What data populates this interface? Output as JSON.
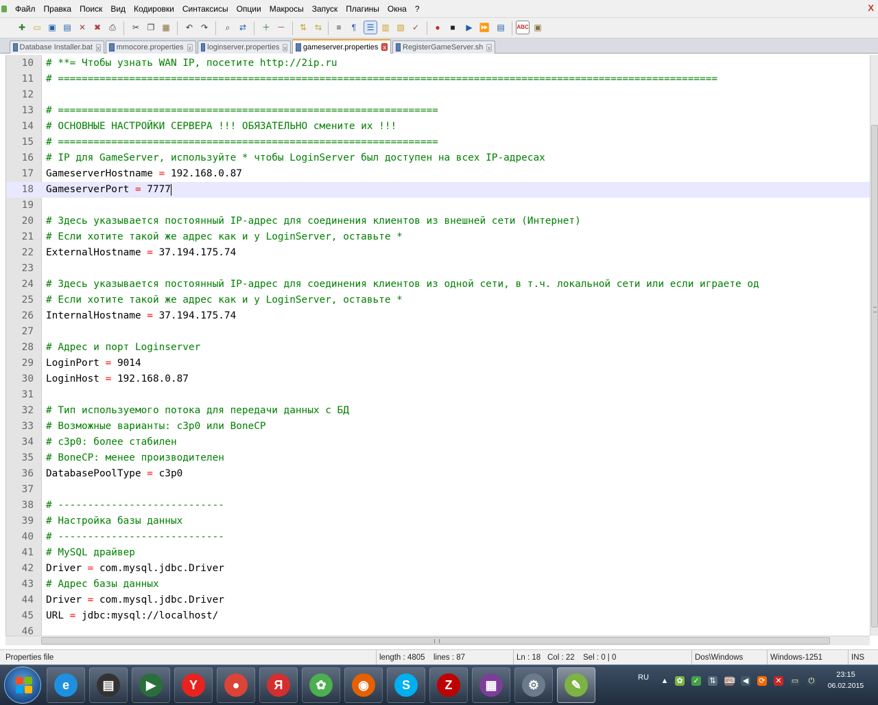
{
  "menu": {
    "items": [
      "Файл",
      "Правка",
      "Поиск",
      "Вид",
      "Кодировки",
      "Синтаксисы",
      "Опции",
      "Макросы",
      "Запуск",
      "Плагины",
      "Окна",
      "?"
    ],
    "close": "X"
  },
  "tabs": [
    {
      "label": "Database Installer.bat",
      "active": false
    },
    {
      "label": "mmocore.properties",
      "active": false
    },
    {
      "label": "loginserver.properties",
      "active": false
    },
    {
      "label": "gameserver.properties",
      "active": true
    },
    {
      "label": "RegisterGameServer.sh",
      "active": false
    }
  ],
  "editor": {
    "lines": [
      {
        "n": "10",
        "type": "comment",
        "text": "# **= Чтобы узнать WAN IP, посетите http://2ip.ru"
      },
      {
        "n": "11",
        "type": "comment",
        "text": "# ==============================================================================================================="
      },
      {
        "n": "12",
        "type": "blank",
        "text": ""
      },
      {
        "n": "13",
        "type": "comment",
        "text": "# ================================================================"
      },
      {
        "n": "14",
        "type": "comment",
        "text": "# ОСНОВНЫЕ НАСТРОЙКИ СЕРВЕРА !!! ОБЯЗАТЕЛЬНО смените их !!!"
      },
      {
        "n": "15",
        "type": "comment",
        "text": "# ================================================================"
      },
      {
        "n": "16",
        "type": "comment",
        "text": "# IP для GameServer, используйте * чтобы LoginServer был доступен на всех IP-адресах"
      },
      {
        "n": "17",
        "type": "kv",
        "key": "GameserverHostname",
        "value": "192.168.0.87"
      },
      {
        "n": "18",
        "type": "kv",
        "key": "GameserverPort",
        "value": "7777",
        "current": true
      },
      {
        "n": "19",
        "type": "blank",
        "text": ""
      },
      {
        "n": "20",
        "type": "comment",
        "text": "# Здесь указывается постоянный IP-адрес для соединения клиентов из внешней сети (Интернет)"
      },
      {
        "n": "21",
        "type": "comment",
        "text": "# Если хотите такой же адрес как и у LoginServer, оставьте *"
      },
      {
        "n": "22",
        "type": "kv",
        "key": "ExternalHostname",
        "value": "37.194.175.74"
      },
      {
        "n": "23",
        "type": "blank",
        "text": ""
      },
      {
        "n": "24",
        "type": "comment",
        "text": "# Здесь указывается постоянный IP-адрес для соединения клиентов из одной сети, в т.ч. локальной сети или если играете од"
      },
      {
        "n": "25",
        "type": "comment",
        "text": "# Если хотите такой же адрес как и у LoginServer, оставьте *"
      },
      {
        "n": "26",
        "type": "kv",
        "key": "InternalHostname",
        "value": "37.194.175.74"
      },
      {
        "n": "27",
        "type": "blank",
        "text": ""
      },
      {
        "n": "28",
        "type": "comment",
        "text": "# Адрес и порт Loginserver"
      },
      {
        "n": "29",
        "type": "kv",
        "key": "LoginPort",
        "value": "9014"
      },
      {
        "n": "30",
        "type": "kv",
        "key": "LoginHost",
        "value": "192.168.0.87"
      },
      {
        "n": "31",
        "type": "blank",
        "text": ""
      },
      {
        "n": "32",
        "type": "comment",
        "text": "# Тип используемого потока для передачи данных с БД"
      },
      {
        "n": "33",
        "type": "comment",
        "text": "# Возможные варианты: c3p0 или BoneCP"
      },
      {
        "n": "34",
        "type": "comment",
        "text": "# c3p0: более стабилен"
      },
      {
        "n": "35",
        "type": "comment",
        "text": "# BoneCP: менее производителен"
      },
      {
        "n": "36",
        "type": "kv",
        "key": "DatabasePoolType",
        "value": "c3p0"
      },
      {
        "n": "37",
        "type": "blank",
        "text": ""
      },
      {
        "n": "38",
        "type": "comment",
        "text": "# ----------------------------"
      },
      {
        "n": "39",
        "type": "comment",
        "text": "# Настройка базы данных"
      },
      {
        "n": "40",
        "type": "comment",
        "text": "# ----------------------------"
      },
      {
        "n": "41",
        "type": "comment",
        "text": "# MySQL драйвер"
      },
      {
        "n": "42",
        "type": "kv",
        "key": "Driver",
        "value": "com.mysql.jdbc.Driver"
      },
      {
        "n": "43",
        "type": "comment",
        "text": "# Адрес базы данных"
      },
      {
        "n": "44",
        "type": "kv",
        "key": "Driver",
        "value": "com.mysql.jdbc.Driver"
      },
      {
        "n": "45",
        "type": "kv",
        "key": "URL",
        "value": "jdbc:mysql://localhost/"
      },
      {
        "n": "46",
        "type": "blank",
        "text": ""
      }
    ]
  },
  "statusbar": {
    "file_type": "Properties file",
    "length": "length : 4805",
    "lines": "lines : 87",
    "ln": "Ln : 18",
    "col": "Col : 22",
    "sel": "Sel : 0 | 0",
    "eol": "Dos\\Windows",
    "encoding": "Windows-1251",
    "mode": "INS"
  },
  "taskbar": {
    "language": "RU",
    "time": "23:15",
    "date": "06.02.2015",
    "apps": [
      {
        "name": "internet-explorer",
        "glyph": "e",
        "color": "#1e90e0"
      },
      {
        "name": "printer",
        "glyph": "▤",
        "color": "#333333"
      },
      {
        "name": "media-player",
        "glyph": "▶",
        "color": "#2a6f3a"
      },
      {
        "name": "yandex-browser",
        "glyph": "Y",
        "color": "#e8231f"
      },
      {
        "name": "chrome",
        "glyph": "●",
        "color": "#db4437"
      },
      {
        "name": "yandex",
        "glyph": "Я",
        "color": "#d32f2f"
      },
      {
        "name": "icq",
        "glyph": "✿",
        "color": "#4caf50"
      },
      {
        "name": "firefox",
        "glyph": "◉",
        "color": "#e66000"
      },
      {
        "name": "skype",
        "glyph": "S",
        "color": "#00aff0"
      },
      {
        "name": "filezilla",
        "glyph": "Z",
        "color": "#bf0000"
      },
      {
        "name": "winrar",
        "glyph": "▦",
        "color": "#7b3f99"
      },
      {
        "name": "game-client",
        "glyph": "⚙",
        "color": "#6b7b8c"
      },
      {
        "name": "notepad-plus-plus",
        "glyph": "✎",
        "color": "#7cb342"
      }
    ]
  }
}
